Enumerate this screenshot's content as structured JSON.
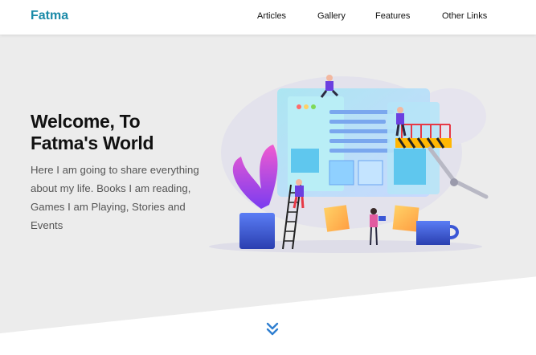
{
  "header": {
    "brand": "Fatma",
    "nav": [
      "Articles",
      "Gallery",
      "Features",
      "Other Links"
    ]
  },
  "hero": {
    "title_line1": "Welcome, To",
    "title_line2": "Fatma's World",
    "description": "Here I am going to share everything about my life. Books I am reading, Games I am Playing, Stories and Events"
  },
  "icons": {
    "scroll": "double-chevron-down-icon"
  },
  "colors": {
    "brand": "#1a8aa8",
    "hero_background": "#ececec",
    "accent": "#2f7fd0"
  }
}
